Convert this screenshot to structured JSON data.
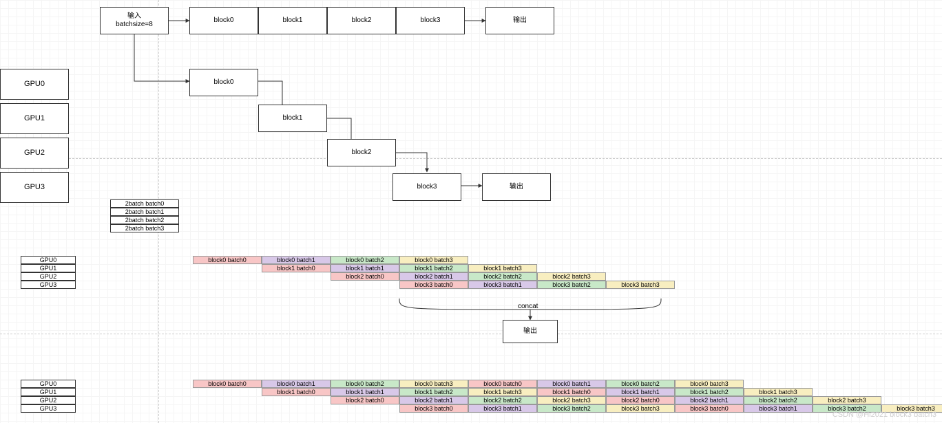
{
  "top": {
    "input": "输入\nbatchsize=8",
    "blocks": [
      "block0",
      "block1",
      "block2",
      "block3"
    ],
    "output": "输出"
  },
  "gpu_col": [
    "GPU0",
    "GPU1",
    "GPU2",
    "GPU3"
  ],
  "stair": {
    "blocks": [
      "block0",
      "block1",
      "block2",
      "block3"
    ],
    "output": "输出"
  },
  "batch_list": [
    "2batch batch0",
    "2batch batch1",
    "2batch batch2",
    "2batch batch3"
  ],
  "gpu_small": [
    "GPU0",
    "GPU1",
    "GPU2",
    "GPU3"
  ],
  "pipeline1": {
    "rows": [
      [
        "block0 batch0",
        "block0 batch1",
        "block0 batch2",
        "block0 batch3"
      ],
      [
        "block1 batch0",
        "block1 batch1",
        "block1 batch2",
        "block1 batch3"
      ],
      [
        "block2 batch0",
        "block2 batch1",
        "block2 batch2",
        "block2 batch3"
      ],
      [
        "block3 batch0",
        "block3 batch1",
        "block3 batch2",
        "block3 batch3"
      ]
    ],
    "concat": "concat",
    "output": "输出"
  },
  "pipeline2": {
    "rows": [
      [
        "block0 batch0",
        "block0 batch1",
        "block0 batch2",
        "block0 batch3",
        "block0 batch0",
        "block0 batch1",
        "block0 batch2",
        "block0 batch3"
      ],
      [
        "block1 batch0",
        "block1 batch1",
        "block1 batch2",
        "block1 batch3",
        "block1 batch0",
        "block1 batch1",
        "block1 batch2",
        "block1 batch3"
      ],
      [
        "block2 batch0",
        "block2 batch1",
        "block2 batch2",
        "block2 batch3",
        "block2 batch0",
        "block2 batch1",
        "block2 batch2",
        "block2 batch3"
      ],
      [
        "block3 batch0",
        "block3 batch1",
        "block3 batch2",
        "block3 batch3",
        "block3 batch0",
        "block3 batch1",
        "block3 batch2",
        "block3 batch3"
      ]
    ]
  },
  "watermark": "CSDN @Hi2021 block3 batch3",
  "colors": {
    "red": "#f8c6c6",
    "purple": "#d8c8e8",
    "green": "#c8e8c8",
    "yellow": "#f8eec0"
  }
}
